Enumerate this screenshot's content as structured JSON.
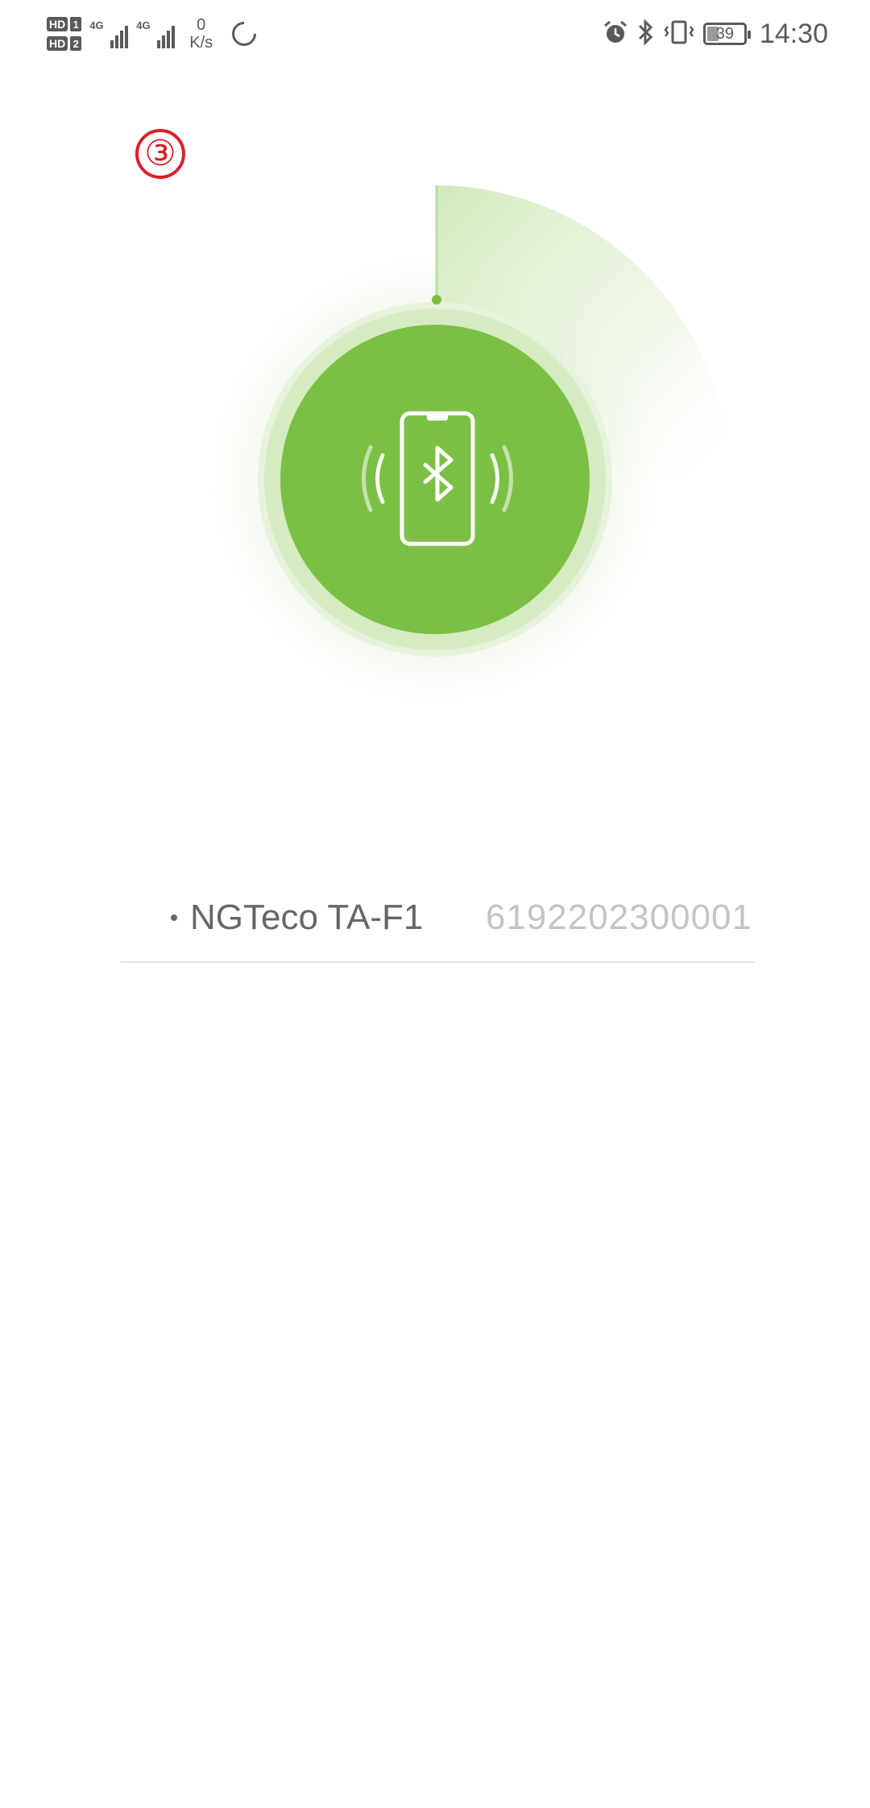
{
  "status_bar": {
    "sim1_badge": "HD",
    "sim1_index": "1",
    "sim2_badge": "HD",
    "sim2_index": "2",
    "network1": "4G",
    "network2": "4G",
    "speed_value": "0",
    "speed_unit": "K/s",
    "battery_level": "39",
    "time": "14:30",
    "icons": [
      "sync-icon",
      "alarm-icon",
      "bluetooth-icon",
      "vibrate-icon",
      "battery-icon"
    ]
  },
  "step_marker": "③",
  "scan": {
    "icon": "phone-bluetooth-icon",
    "colors": {
      "primary_green": "#7cbf45",
      "light_green": "#cfe8b8",
      "halo": "#eef6e6"
    }
  },
  "devices": [
    {
      "name": "NGTeco TA-F1",
      "serial": "6192202300001"
    }
  ]
}
